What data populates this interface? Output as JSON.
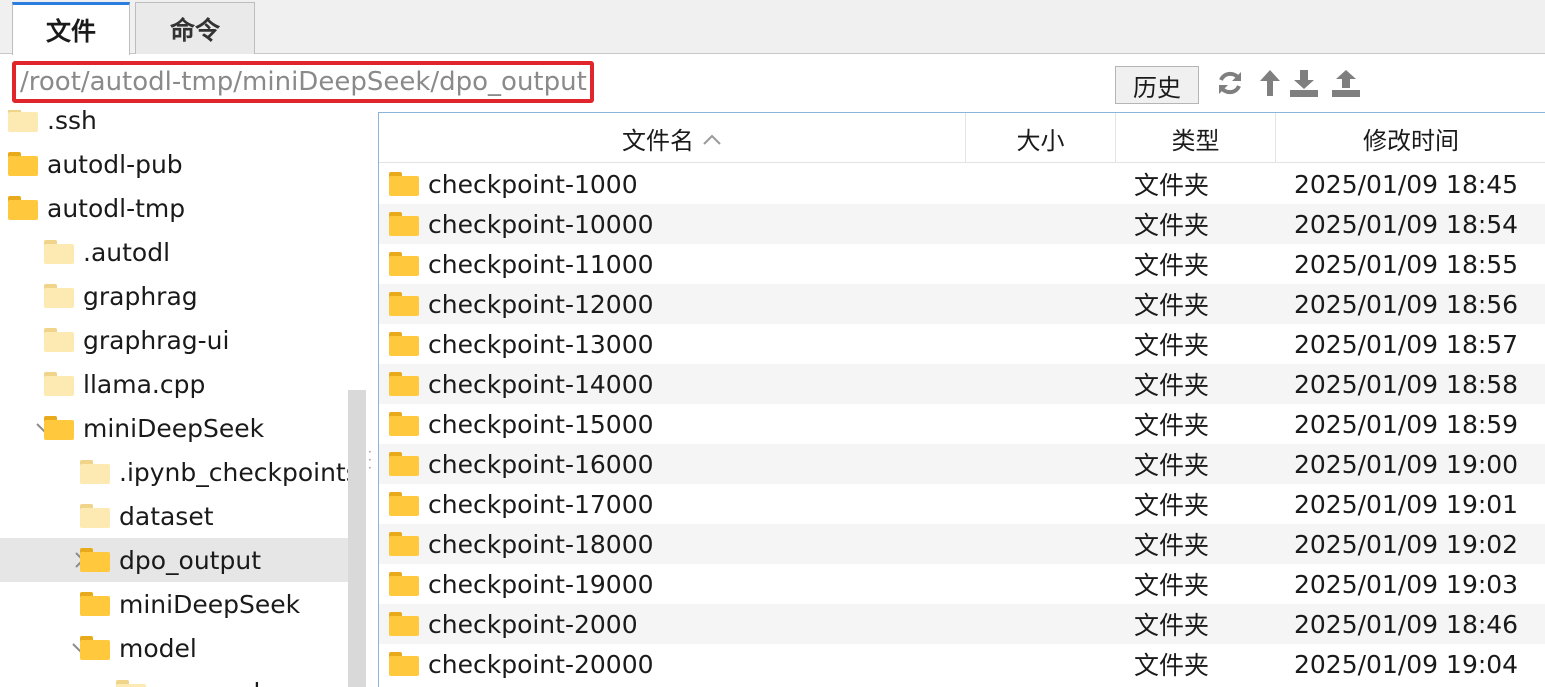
{
  "tabs": [
    {
      "label": "文件",
      "active": true
    },
    {
      "label": "命令",
      "active": false
    }
  ],
  "path": {
    "value": "/root/autodl-tmp/miniDeepSeek/dpo_output"
  },
  "toolbar": {
    "history_label": "历史",
    "icons": [
      "refresh-icon",
      "up-arrow-icon",
      "download-icon",
      "upload-icon"
    ]
  },
  "tree": [
    {
      "label": ".ssh",
      "indent": 0,
      "folder": "pale",
      "expander": ""
    },
    {
      "label": "autodl-pub",
      "indent": 0,
      "folder": "yellow",
      "expander": ""
    },
    {
      "label": "autodl-tmp",
      "indent": 0,
      "folder": "yellow",
      "expander": ""
    },
    {
      "label": ".autodl",
      "indent": 1,
      "folder": "pale",
      "expander": ""
    },
    {
      "label": "graphrag",
      "indent": 1,
      "folder": "pale",
      "expander": ""
    },
    {
      "label": "graphrag-ui",
      "indent": 1,
      "folder": "pale",
      "expander": ""
    },
    {
      "label": "llama.cpp",
      "indent": 1,
      "folder": "pale",
      "expander": ""
    },
    {
      "label": "miniDeepSeek",
      "indent": 1,
      "folder": "yellow",
      "expander": "expanded"
    },
    {
      "label": ".ipynb_checkpoints",
      "indent": 2,
      "folder": "pale",
      "expander": ""
    },
    {
      "label": "dataset",
      "indent": 2,
      "folder": "pale",
      "expander": ""
    },
    {
      "label": "dpo_output",
      "indent": 2,
      "folder": "yellow",
      "expander": "collapsed",
      "selected": true
    },
    {
      "label": "miniDeepSeek",
      "indent": 2,
      "folder": "yellow",
      "expander": ""
    },
    {
      "label": "model",
      "indent": 2,
      "folder": "yellow",
      "expander": "expanded"
    },
    {
      "label": "__pycache__",
      "indent": 3,
      "folder": "pale",
      "expander": ""
    }
  ],
  "columns": {
    "name": "文件名",
    "size": "大小",
    "type": "类型",
    "modified": "修改时间",
    "sort_indicator": "^"
  },
  "files": [
    {
      "name": "checkpoint-1000",
      "size": "",
      "type": "文件夹",
      "modified": "2025/01/09 18:45"
    },
    {
      "name": "checkpoint-10000",
      "size": "",
      "type": "文件夹",
      "modified": "2025/01/09 18:54"
    },
    {
      "name": "checkpoint-11000",
      "size": "",
      "type": "文件夹",
      "modified": "2025/01/09 18:55"
    },
    {
      "name": "checkpoint-12000",
      "size": "",
      "type": "文件夹",
      "modified": "2025/01/09 18:56"
    },
    {
      "name": "checkpoint-13000",
      "size": "",
      "type": "文件夹",
      "modified": "2025/01/09 18:57"
    },
    {
      "name": "checkpoint-14000",
      "size": "",
      "type": "文件夹",
      "modified": "2025/01/09 18:58"
    },
    {
      "name": "checkpoint-15000",
      "size": "",
      "type": "文件夹",
      "modified": "2025/01/09 18:59"
    },
    {
      "name": "checkpoint-16000",
      "size": "",
      "type": "文件夹",
      "modified": "2025/01/09 19:00"
    },
    {
      "name": "checkpoint-17000",
      "size": "",
      "type": "文件夹",
      "modified": "2025/01/09 19:01"
    },
    {
      "name": "checkpoint-18000",
      "size": "",
      "type": "文件夹",
      "modified": "2025/01/09 19:02"
    },
    {
      "name": "checkpoint-19000",
      "size": "",
      "type": "文件夹",
      "modified": "2025/01/09 19:03"
    },
    {
      "name": "checkpoint-2000",
      "size": "",
      "type": "文件夹",
      "modified": "2025/01/09 18:46"
    },
    {
      "name": "checkpoint-20000",
      "size": "",
      "type": "文件夹",
      "modified": "2025/01/09 19:04"
    }
  ],
  "colors": {
    "accent": "#2b7de0",
    "highlight_border": "#e0262a",
    "folder": "#ffc83d"
  }
}
